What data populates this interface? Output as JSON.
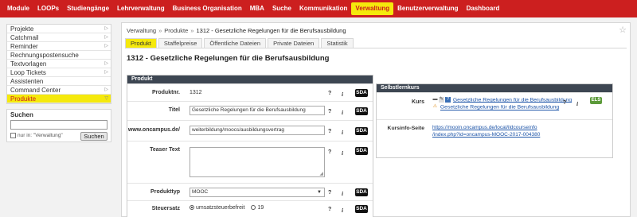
{
  "topnav": {
    "items": [
      {
        "label": "Module"
      },
      {
        "label": "LOOPs"
      },
      {
        "label": "Studiengänge"
      },
      {
        "label": "Lehrverwaltung"
      },
      {
        "label": "Business Organisation"
      },
      {
        "label": "MBA"
      },
      {
        "label": "Suche"
      },
      {
        "label": "Kommunikation"
      },
      {
        "label": "Verwaltung",
        "active": true
      },
      {
        "label": "Benutzerverwaltung"
      },
      {
        "label": "Dashboard"
      }
    ]
  },
  "sidebar": {
    "items": [
      {
        "label": "Projekte"
      },
      {
        "label": "Catchmail"
      },
      {
        "label": "Reminder"
      },
      {
        "label": "Rechnungspostensuche"
      },
      {
        "label": "Textvorlagen"
      },
      {
        "label": "Loop Tickets"
      },
      {
        "label": "Assistenten"
      },
      {
        "label": "Command Center"
      },
      {
        "label": "Produkte",
        "active": true
      }
    ],
    "search": {
      "title": "Suchen",
      "value": "",
      "checkbox_label": "nur in: \"Verwaltung\"",
      "button_label": "Suchen"
    }
  },
  "breadcrumb": {
    "items": [
      "Verwaltung",
      "Produkte",
      "1312 - Gesetzliche Regelungen für die Berufsausbildung"
    ],
    "separator": "»"
  },
  "tabs": [
    {
      "label": "Produkt",
      "active": true
    },
    {
      "label": "Staffelpreise"
    },
    {
      "label": "Öffentliche Dateien"
    },
    {
      "label": "Private Dateien"
    },
    {
      "label": "Statistik"
    }
  ],
  "page_title": "1312 - Gesetzliche Regelungen für die Berufsausbildung",
  "produkt_panel": {
    "header": "Produkt",
    "help": "?",
    "info": "i",
    "sda": "SDA",
    "rows": {
      "produktnr": {
        "label": "Produktnr.",
        "value": "1312"
      },
      "titel": {
        "label": "Titel",
        "value": "Gesetzliche Regelungen für die Berufsausbildung"
      },
      "url": {
        "label": "www.oncampus.de/",
        "value": "weiterbildung/moocs/ausbildungsvertrag"
      },
      "teaser": {
        "label": "Teaser Text",
        "value": ""
      },
      "produkttyp": {
        "label": "Produkttyp",
        "value": "MOOC"
      },
      "steuersatz": {
        "label": "Steuersatz",
        "option1": "umsatzsteuerbefreit",
        "option2": "19"
      }
    }
  },
  "selbstlernkurs_panel": {
    "header": "Selbstlernkurs",
    "kurs_label": "Kurs",
    "kurs_link1": "Gesetzliche Regelungen für die Berufsausbildung",
    "kurs_link2": "Gesetzliche Regelungen für die Berufsausbildung",
    "help": "?",
    "info": "i",
    "els": "ELS",
    "kursinfo_label": "Kursinfo-Seite",
    "kursinfo_line1": "https://mooin.oncampus.de/local/ildcourseinfo",
    "kursinfo_line2": "/index.php?id=oncampus-MOOC-2017-004380"
  },
  "colors": {
    "brand_red": "#cc1f1f",
    "active_yellow": "#f5e90c",
    "panel_header": "#3d4652",
    "link_blue": "#1e55a8",
    "els_green": "#5c9a3a"
  }
}
